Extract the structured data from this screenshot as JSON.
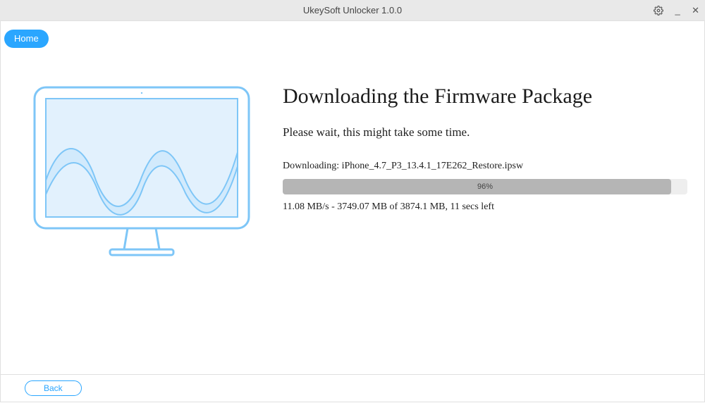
{
  "titlebar": {
    "title": "UkeySoft Unlocker 1.0.0"
  },
  "nav": {
    "home_label": "Home"
  },
  "main": {
    "heading": "Downloading the Firmware Package",
    "subheading": "Please wait, this might take some time.",
    "download_prefix": "Downloading:",
    "download_file": "iPhone_4.7_P3_13.4.1_17E262_Restore.ipsw",
    "progress_percent_label": "96%",
    "progress_percent_value": 96,
    "progress_stats": "11.08 MB/s - 3749.07 MB of 3874.1 MB, 11 secs left"
  },
  "footer": {
    "back_label": "Back"
  },
  "colors": {
    "accent": "#2aa6ff",
    "illustration_stroke": "#7ec6f7",
    "illustration_fill": "#e2f1fd"
  }
}
